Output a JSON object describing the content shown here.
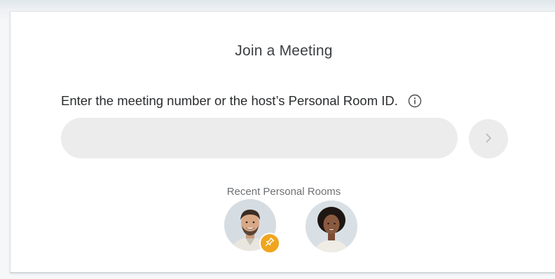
{
  "dialog": {
    "title": "Join a Meeting",
    "prompt": "Enter the meeting number or the host’s Personal Room ID.",
    "info_icon": "info-icon",
    "input": {
      "value": "",
      "placeholder": ""
    },
    "go_icon": "chevron-right-icon"
  },
  "recent": {
    "label": "Recent Personal Rooms",
    "rooms": [
      {
        "avatar": "man-avatar",
        "pinned": true,
        "badge_icon": "pin-icon",
        "badge_color": "#f0a51e"
      },
      {
        "avatar": "woman-avatar",
        "pinned": false
      }
    ]
  },
  "colors": {
    "input_background": "#ececec",
    "text": "#2a2c2e",
    "pin_badge": "#f0a51e"
  }
}
